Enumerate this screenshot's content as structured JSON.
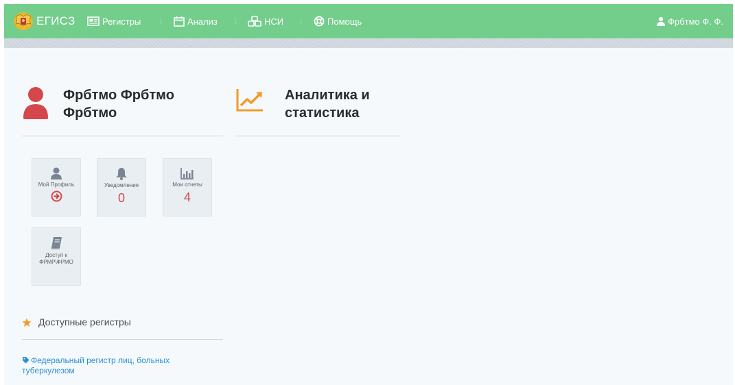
{
  "navbar": {
    "brand": "ЕГИСЗ",
    "items": [
      {
        "label": "Регистры",
        "icon": "registry-icon"
      },
      {
        "label": "Анализ",
        "icon": "calendar-icon"
      },
      {
        "label": "НСИ",
        "icon": "cubes-icon"
      },
      {
        "label": "Помощь",
        "icon": "lifebuoy-icon"
      }
    ],
    "user": "Фрбтмо Ф. Ф."
  },
  "profile": {
    "name": "Фрбтмо Фрбтмо Фрбтмо"
  },
  "analytics": {
    "title": "Аналитика и статистика"
  },
  "tiles": [
    {
      "label": "Мой Профиль",
      "icon": "user-icon",
      "value": ""
    },
    {
      "label": "Уведомления",
      "icon": "bell-icon",
      "value": "0"
    },
    {
      "label": "Мои отчеты",
      "icon": "bar-chart-icon",
      "value": "4"
    },
    {
      "label": "Доступ к ФРМР\\ФРМО",
      "icon": "book-icon",
      "value": ""
    }
  ],
  "registries": {
    "title": "Доступные регистры",
    "items": [
      {
        "label": "Федеральный регистр лиц, больных туберкулезом"
      }
    ]
  },
  "colors": {
    "navbar": "#73cd8b",
    "accent_red": "#d4474b",
    "accent_orange": "#f39a2b",
    "link": "#2a8fd6"
  }
}
